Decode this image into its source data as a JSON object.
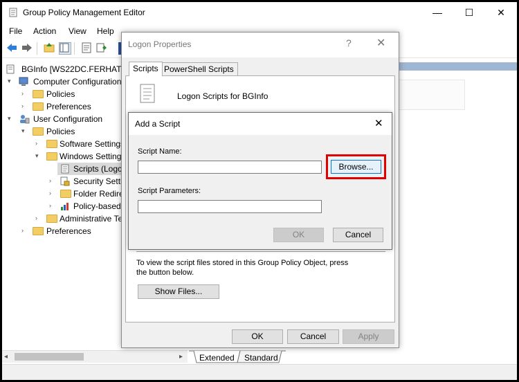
{
  "window": {
    "title": "Group Policy Management Editor",
    "minimize": "—",
    "maximize": "☐",
    "close": "✕"
  },
  "menu": [
    "File",
    "Action",
    "View",
    "Help"
  ],
  "tree": {
    "root": "BGInfo [WS22DC.FERHATULT",
    "items": [
      {
        "label": "Computer Configuration"
      },
      {
        "label": "Policies"
      },
      {
        "label": "Preferences"
      },
      {
        "label": "User Configuration"
      },
      {
        "label": "Policies"
      },
      {
        "label": "Software Settings"
      },
      {
        "label": "Windows Setting"
      },
      {
        "label": "Scripts (Logo"
      },
      {
        "label": "Security Settin"
      },
      {
        "label": "Folder Redire"
      },
      {
        "label": "Policy-based"
      },
      {
        "label": "Administrative Te"
      },
      {
        "label": "Preferences"
      }
    ]
  },
  "bottom_tabs": [
    "Extended",
    "Standard"
  ],
  "logon_dialog": {
    "title": "Logon Properties",
    "help": "?",
    "close": "✕",
    "tabs": [
      "Scripts",
      "PowerShell Scripts"
    ],
    "heading": "Logon Scripts for BGInfo",
    "info_text_1": "To view the script files stored in this Group Policy Object, press",
    "info_text_2": "the button below.",
    "show_files": "Show Files...",
    "ok": "OK",
    "cancel": "Cancel",
    "apply": "Apply"
  },
  "add_dialog": {
    "title": "Add a Script",
    "close": "✕",
    "script_name_label": "Script Name:",
    "script_name_value": "",
    "browse": "Browse...",
    "params_label": "Script Parameters:",
    "params_value": "",
    "ok": "OK",
    "cancel": "Cancel"
  },
  "colors": {
    "highlight": "#e00000",
    "selection_strip": "#9fb7d2"
  }
}
